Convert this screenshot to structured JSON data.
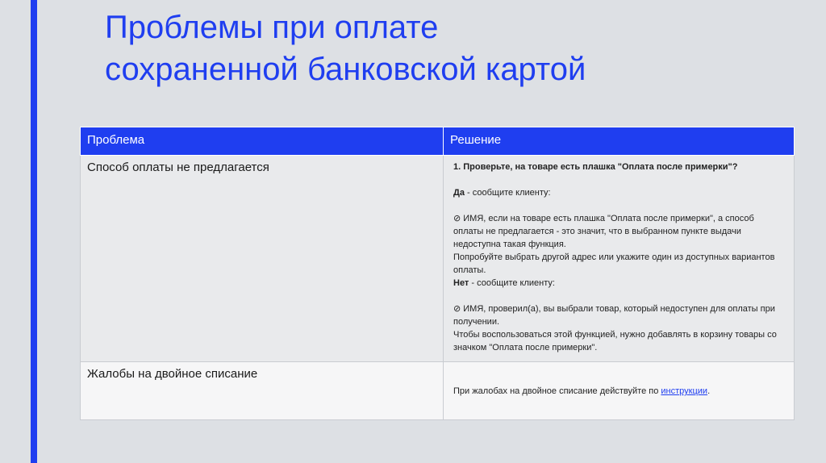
{
  "slide": {
    "title_line1": "Проблемы при оплате",
    "title_line2": "сохраненной банковской картой"
  },
  "table": {
    "headers": [
      "Проблема",
      "Решение"
    ],
    "rows": [
      {
        "problem": "Способ оплаты не предлагается",
        "solution": {
          "step1": "1. Проверьте, на товаре есть плашка \"Оплата после примерки\"?",
          "yes_label": "Да",
          "yes_text": " - сообщите клиенту:",
          "yes_msg1": "⊘ ИМЯ, если на товаре есть плашка \"Оплата после примерки\", а способ оплаты не предлагается - это значит, что в выбранном пункте выдачи недоступна такая функция.",
          "yes_msg2": "Попробуйте выбрать другой адрес или укажите один из доступных вариантов оплаты.",
          "no_label": "Нет",
          "no_text": " - сообщите клиенту:",
          "no_msg1": "⊘ ИМЯ, проверил(а), вы выбрали товар, который недоступен для оплаты при получении.",
          "no_msg2": "Чтобы воспользоваться этой функцией, нужно добавлять в корзину товары со значком \"Оплата после примерки\"."
        }
      },
      {
        "problem": "Жалобы на двойное списание",
        "solution": {
          "text": "При жалобах на двойное списание действуйте по ",
          "link": "инструкции",
          "end": "."
        }
      }
    ]
  },
  "colors": {
    "accent": "#1f3ef0",
    "background": "#dde0e4"
  }
}
